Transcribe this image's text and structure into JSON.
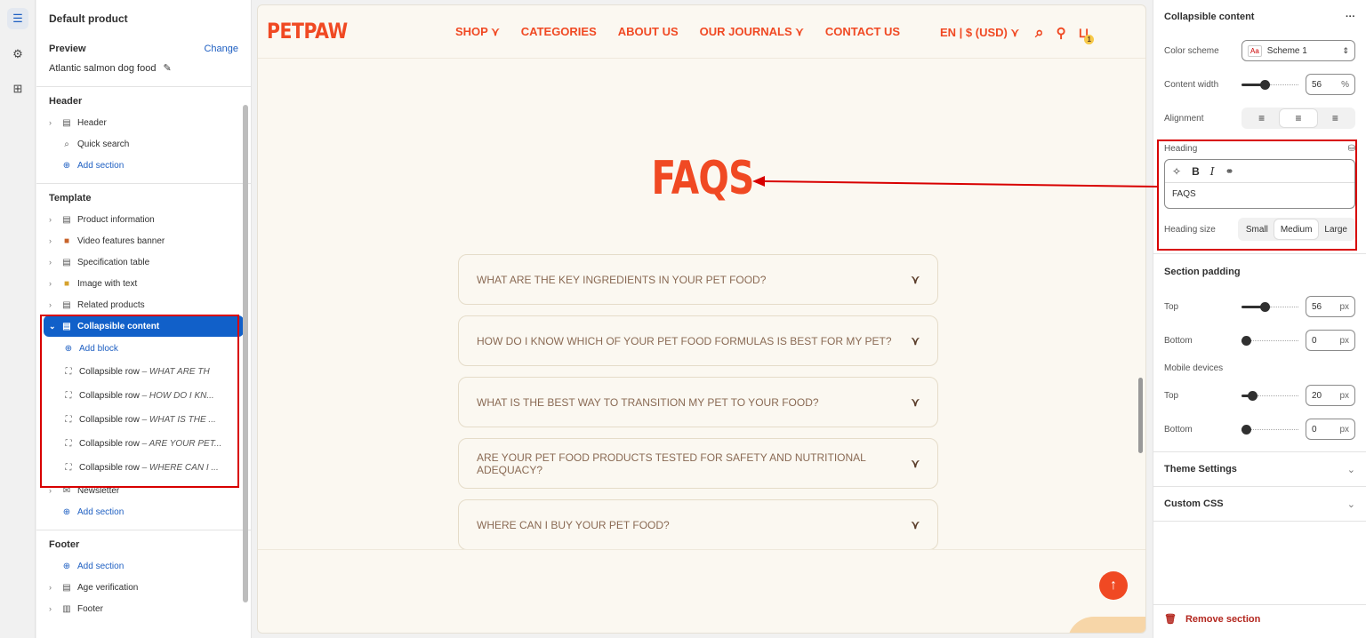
{
  "rail": {
    "icons": [
      "sections-icon",
      "settings-icon",
      "apps-icon"
    ]
  },
  "left": {
    "product_title": "Default product",
    "preview_label": "Preview",
    "change_label": "Change",
    "preview_product": "Atlantic salmon dog food",
    "header_group": {
      "title": "Header",
      "items": [
        {
          "label": "Header",
          "icon": "layout-icon"
        },
        {
          "label": "Quick search",
          "icon": "search-icon"
        },
        {
          "label": "Add section",
          "icon": "plus-circle-icon"
        }
      ]
    },
    "template_group": {
      "title": "Template",
      "items": [
        {
          "label": "Product information"
        },
        {
          "label": "Video features banner"
        },
        {
          "label": "Specification table"
        },
        {
          "label": "Image with text"
        },
        {
          "label": "Related products"
        },
        {
          "label": "Collapsible content"
        },
        {
          "label": "Add block"
        },
        {
          "label": "Collapsible row",
          "suffix": "– WHAT ARE TH"
        },
        {
          "label": "Collapsible row",
          "suffix": "– HOW DO I KN..."
        },
        {
          "label": "Collapsible row",
          "suffix": "– WHAT IS THE ..."
        },
        {
          "label": "Collapsible row",
          "suffix": "– ARE YOUR PET..."
        },
        {
          "label": "Collapsible row",
          "suffix": "– WHERE CAN I ..."
        },
        {
          "label": "Newsletter"
        },
        {
          "label": "Add section"
        }
      ]
    },
    "footer_group": {
      "title": "Footer",
      "items": [
        {
          "label": "Add section"
        },
        {
          "label": "Age verification"
        },
        {
          "label": "Footer"
        }
      ]
    }
  },
  "store": {
    "logo": "PETPAW",
    "menu": [
      "SHOP",
      "CATEGORIES",
      "ABOUT US",
      "OUR JOURNALS",
      "CONTACT US"
    ],
    "locale": "EN | $ (USD)",
    "cart_count": "1",
    "heading": "FAQS",
    "faqs": [
      "WHAT ARE THE KEY INGREDIENTS IN YOUR PET FOOD?",
      "HOW DO I KNOW WHICH OF YOUR PET FOOD FORMULAS IS BEST FOR MY PET?",
      "WHAT IS THE BEST WAY TO TRANSITION MY PET TO YOUR FOOD?",
      "ARE YOUR PET FOOD PRODUCTS TESTED FOR SAFETY AND NUTRITIONAL ADEQUACY?",
      "WHERE CAN I BUY YOUR PET FOOD?"
    ],
    "accent_color": "#f04923"
  },
  "right": {
    "title": "Collapsible content",
    "more": "···",
    "color_scheme_label": "Color scheme",
    "color_scheme_value": "Scheme 1",
    "color_scheme_badge": "Aa",
    "content_width_label": "Content width",
    "content_width_value": "56",
    "content_width_unit": "%",
    "content_width_fraction": 0.56,
    "alignment_label": "Alignment",
    "alignment_value": "center",
    "heading_label": "Heading",
    "heading_value": "FAQS",
    "heading_size_label": "Heading size",
    "heading_sizes": [
      "Small",
      "Medium",
      "Large"
    ],
    "heading_size_selected": "Medium",
    "section_padding_title": "Section padding",
    "top_label": "Top",
    "top_value": "56",
    "bottom_label": "Bottom",
    "bottom_value": "0",
    "mobile_label": "Mobile devices",
    "m_top_label": "Top",
    "m_top_value": "20",
    "m_bottom_label": "Bottom",
    "m_bottom_value": "0",
    "px": "px",
    "theme_settings": "Theme Settings",
    "custom_css": "Custom CSS",
    "remove_section": "Remove section"
  }
}
